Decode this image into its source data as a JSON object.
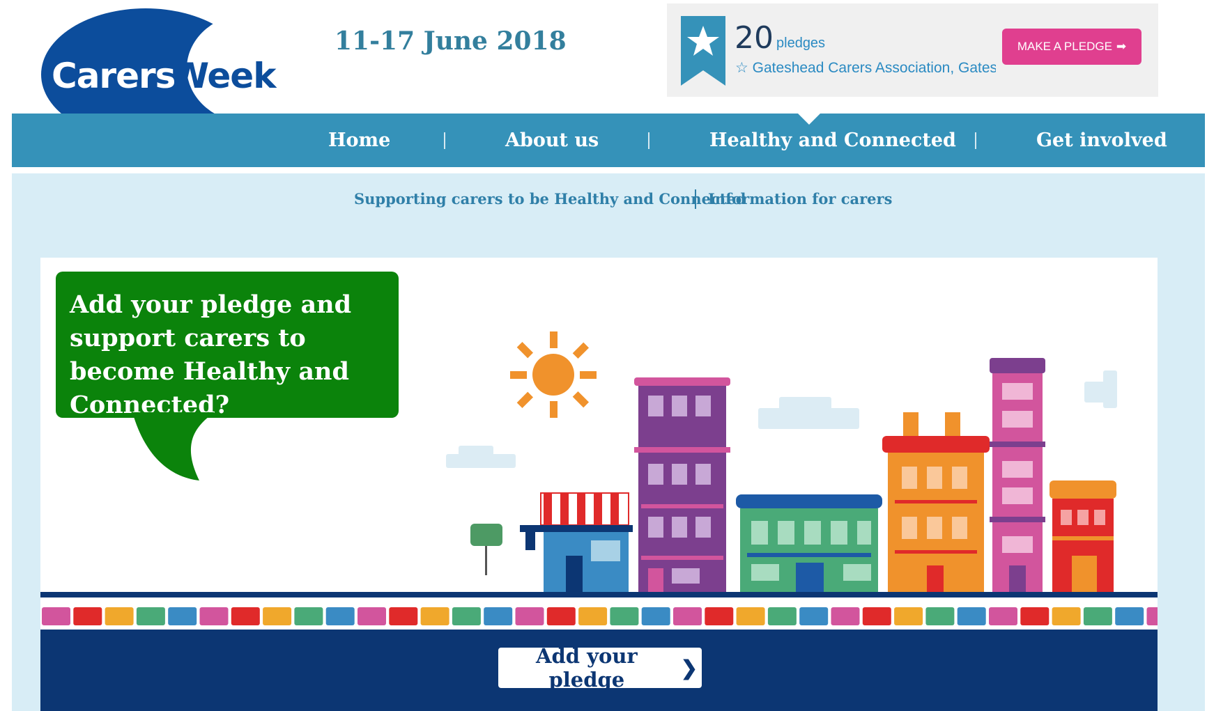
{
  "header": {
    "logo": {
      "word1": "Carers",
      "word2": "Week"
    },
    "date": "11-17 June 2018",
    "pledges": {
      "count": "20",
      "label": "pledges",
      "latest": "☆ Gateshead Carers Association, Gateshead",
      "button_label": "MAKE A PLEDGE"
    }
  },
  "nav": {
    "items": [
      {
        "label": "Home"
      },
      {
        "label": "About us"
      },
      {
        "label": "Healthy and Connected",
        "active": true
      },
      {
        "label": "Get involved"
      }
    ]
  },
  "subnav": {
    "items": [
      {
        "label": "Supporting carers to be Healthy and Connected"
      },
      {
        "label": "Information for carers"
      }
    ]
  },
  "banner": {
    "speech_text": "Add your pledge and support carers to become Healthy and Connected?",
    "cta_label": "Add your pledge"
  },
  "colors": {
    "brand_blue": "#0c4d9c",
    "nav_blue": "#3592b9",
    "pledge_pink": "#e03f8f",
    "speech_green": "#0b830b",
    "footer_navy": "#0c3673",
    "light_blue_bg": "#d8edf6"
  }
}
